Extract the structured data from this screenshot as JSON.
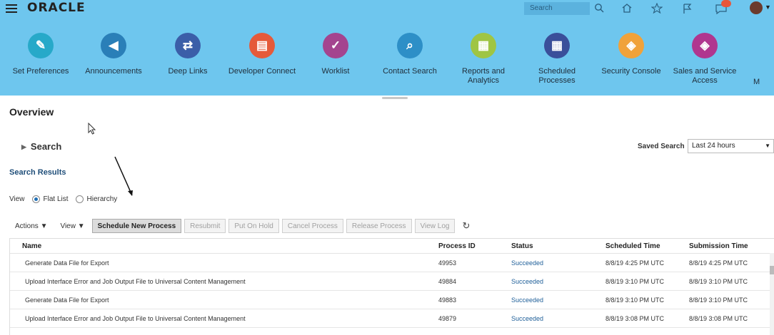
{
  "header": {
    "logo": "ORACLE",
    "search_placeholder": "Search",
    "icons": [
      "search-icon",
      "home-icon",
      "favorites-star-icon",
      "flag-icon",
      "notifications-icon",
      "user-avatar"
    ]
  },
  "tiles": [
    {
      "label": "Set Preferences",
      "icon": "set-preferences-icon",
      "color": "#27a9c9"
    },
    {
      "label": "Announcements",
      "icon": "megaphone-icon",
      "color": "#2a7fb8"
    },
    {
      "label": "Deep Links",
      "icon": "deep-links-icon",
      "color": "#3b5ea8"
    },
    {
      "label": "Developer Connect",
      "icon": "developer-connect-icon",
      "color": "#e55a3a"
    },
    {
      "label": "Worklist",
      "icon": "worklist-icon",
      "color": "#a4448f"
    },
    {
      "label": "Contact Search",
      "icon": "contact-search-icon",
      "color": "#2d8fc7"
    },
    {
      "label": "Reports and Analytics",
      "icon": "reports-icon",
      "color": "#9fc544"
    },
    {
      "label": "Scheduled Processes",
      "icon": "calendar-icon",
      "color": "#3a4f9a"
    },
    {
      "label": "Security Console",
      "icon": "security-shield-icon",
      "color": "#f0a23a"
    },
    {
      "label": "Sales and Service Access",
      "icon": "sales-shield-icon",
      "color": "#b0368f"
    }
  ],
  "overflow_label": "M",
  "page": {
    "title": "Overview",
    "search_section": "Search",
    "saved_search_label": "Saved Search",
    "saved_search_value": "Last 24 hours",
    "results_title": "Search Results"
  },
  "view": {
    "label": "View",
    "options": [
      "Flat List",
      "Hierarchy"
    ],
    "selected": "Flat List"
  },
  "toolbar": {
    "actions_menu": "Actions ▼",
    "view_menu": "View ▼",
    "buttons": [
      "Schedule New Process",
      "Resubmit",
      "Put On Hold",
      "Cancel Process",
      "Release Process",
      "View Log"
    ]
  },
  "table": {
    "columns": [
      "Name",
      "Process ID",
      "Status",
      "Scheduled Time",
      "Submission Time"
    ],
    "rows": [
      [
        "Generate Data File for Export",
        "49953",
        "Succeeded",
        "8/8/19 4:25 PM UTC",
        "8/8/19 4:25 PM UTC"
      ],
      [
        "Upload Interface Error and Job Output File to Universal Content Management",
        "49884",
        "Succeeded",
        "8/8/19 3:10 PM UTC",
        "8/8/19 3:10 PM UTC"
      ],
      [
        "Generate Data File for Export",
        "49883",
        "Succeeded",
        "8/8/19 3:10 PM UTC",
        "8/8/19 3:10 PM UTC"
      ],
      [
        "Upload Interface Error and Job Output File to Universal Content Management",
        "49879",
        "Succeeded",
        "8/8/19 3:08 PM UTC",
        "8/8/19 3:08 PM UTC"
      ]
    ]
  },
  "colors": {
    "header_bg": "#6ec6ee",
    "status_link": "#1f5f99",
    "results_title": "#1f4e79"
  }
}
